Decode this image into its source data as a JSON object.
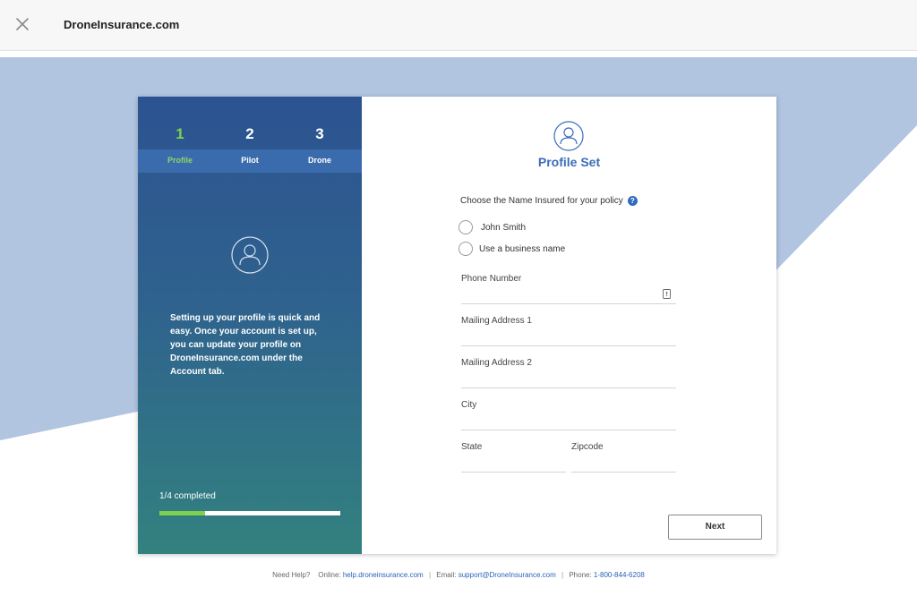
{
  "app": {
    "title": "DroneInsurance.com"
  },
  "icons": {
    "close": "close-icon",
    "avatar": "user-avatar-icon",
    "help": "question-circle-icon",
    "phone": "phone-icon"
  },
  "colors": {
    "accent": "#3b6db8",
    "progress": "#7ed14e",
    "panel_top": "#2c5391",
    "panel_bottom": "#32817f"
  },
  "steps": [
    {
      "number": "1",
      "label": "Profile",
      "active": true
    },
    {
      "number": "2",
      "label": "Pilot",
      "active": false
    },
    {
      "number": "3",
      "label": "Drone",
      "active": false
    }
  ],
  "sidebar": {
    "description": "Setting up your profile is quick and easy. Once your account is set up, you can update your profile on DroneInsurance.com under the Account tab.",
    "progress_label": "1/4 completed",
    "progress_fraction": 0.25
  },
  "form": {
    "title": "Profile Set",
    "question": "Choose the Name Insured for your policy",
    "help_glyph": "?",
    "options": [
      "John Smith",
      "Use a business name"
    ],
    "fields": {
      "phone": {
        "label": "Phone Number",
        "value": ""
      },
      "address1": {
        "label": "Mailing Address 1",
        "value": ""
      },
      "address2": {
        "label": "Mailing Address 2",
        "value": ""
      },
      "city": {
        "label": "City",
        "value": ""
      },
      "state": {
        "label": "State",
        "value": ""
      },
      "zipcode": {
        "label": "Zipcode",
        "value": ""
      }
    },
    "next_label": "Next"
  },
  "footer": {
    "help": "Need Help?",
    "online_label": "Online:",
    "online_link": "help.droneinsurance.com",
    "sep": "|",
    "email_label": "Email:",
    "email_link": "support@DroneInsurance.com",
    "phone_label": "Phone:",
    "phone_link": "1-800-844-6208"
  }
}
